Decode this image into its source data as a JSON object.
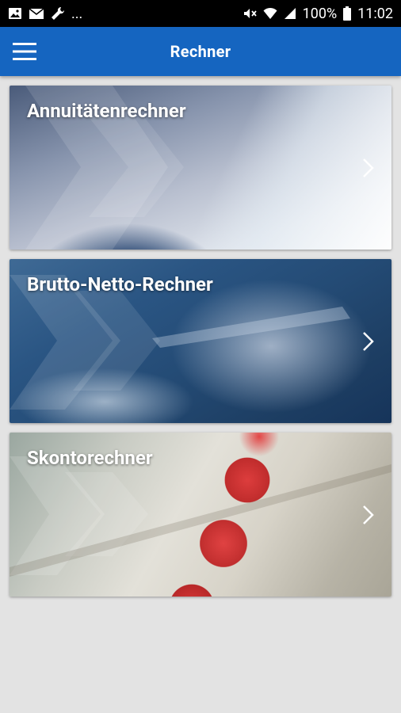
{
  "status_bar": {
    "battery": "100%",
    "time": "11:02",
    "overflow": "..."
  },
  "app_bar": {
    "title": "Rechner",
    "menu_icon": "hamburger-menu-icon"
  },
  "cards": [
    {
      "title": "Annuitätenrechner",
      "icon": "chevron-right-icon"
    },
    {
      "title": "Brutto-Netto-Rechner",
      "icon": "chevron-right-icon"
    },
    {
      "title": "Skontorechner",
      "icon": "chevron-right-icon"
    }
  ],
  "colors": {
    "app_bar": "#1565c0",
    "background": "#e3e3e3",
    "status_bar": "#000000"
  }
}
